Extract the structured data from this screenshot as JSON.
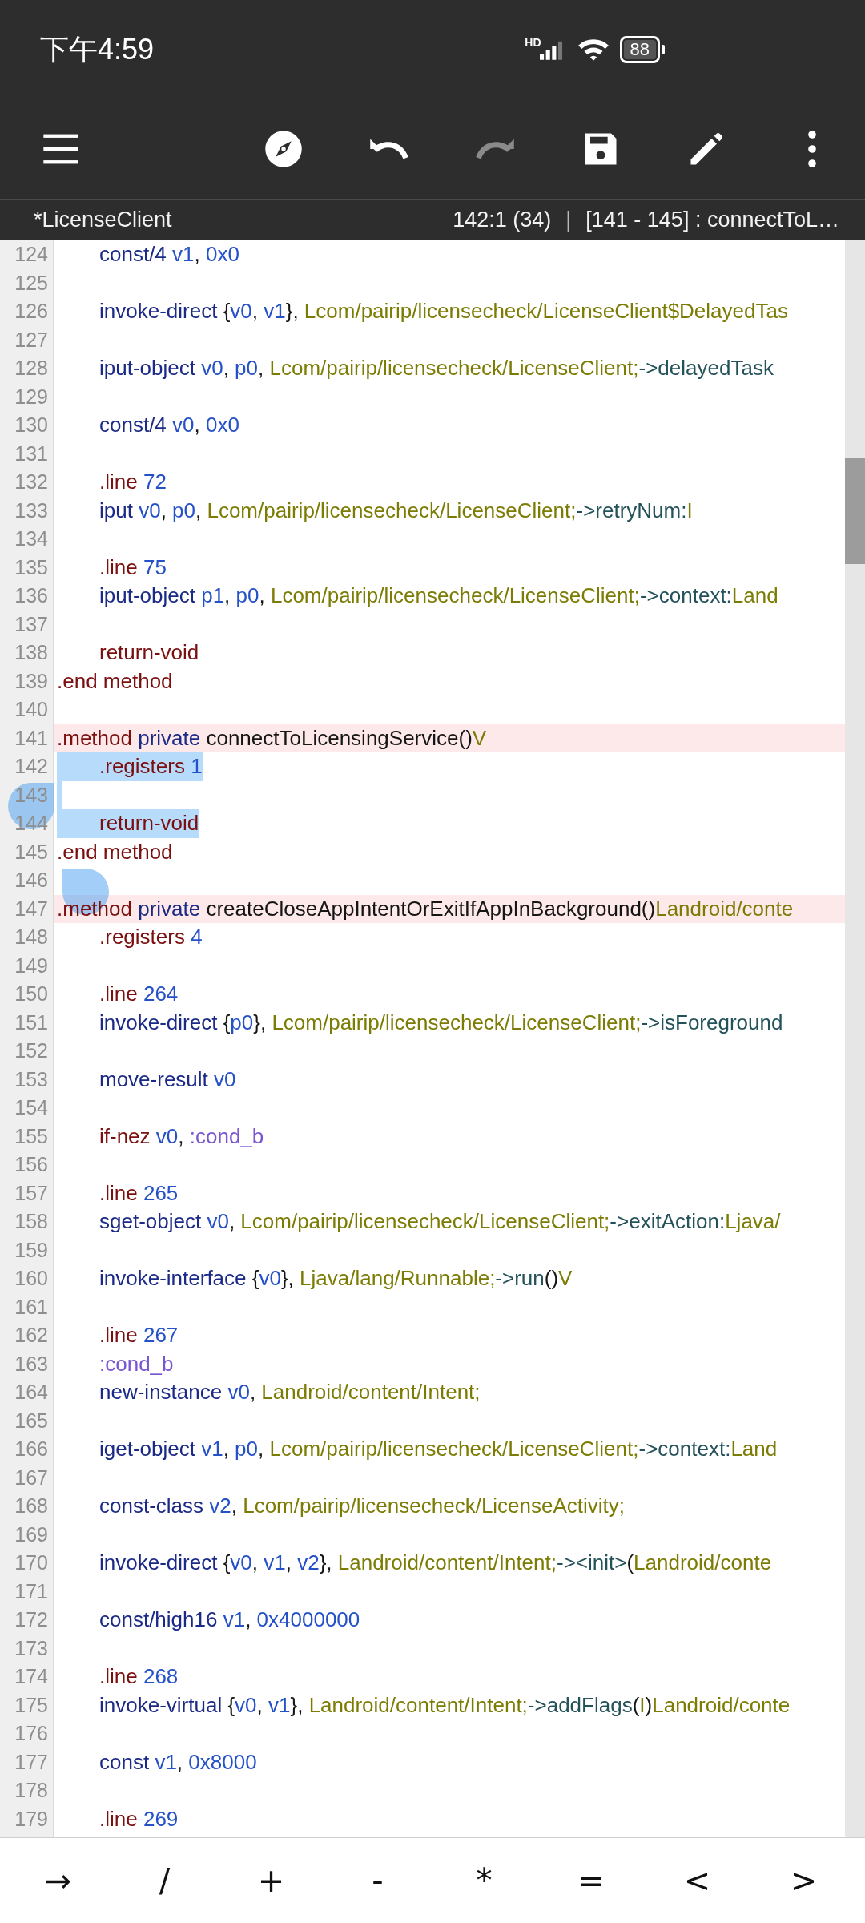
{
  "status_bar": {
    "time": "下午4:59",
    "network": "HD",
    "battery": "88"
  },
  "toolbar": [
    {
      "kind": "menu",
      "disabled": false
    },
    {
      "kind": "compass",
      "disabled": false
    },
    {
      "kind": "undo",
      "disabled": false
    },
    {
      "kind": "redo",
      "disabled": true
    },
    {
      "kind": "save",
      "disabled": false
    },
    {
      "kind": "edit",
      "disabled": false
    },
    {
      "kind": "more",
      "disabled": false
    }
  ],
  "file_bar": {
    "file_name": "*LicenseClient",
    "cursor": "142:1 (34)",
    "separator": "|",
    "scope": "[141 - 145] : connectToL…"
  },
  "editor": {
    "lines": [
      {
        "number": "124",
        "indented": true,
        "highlighted": false,
        "selected": false,
        "tokens": [
          {
            "text": "const/4 ",
            "kind": "op"
          },
          {
            "text": "v1",
            "kind": "reg"
          },
          {
            "text": ", ",
            "kind": "plain"
          },
          {
            "text": "0x0",
            "kind": "reg"
          }
        ]
      },
      {
        "number": "125",
        "highlighted": false,
        "selected": false
      },
      {
        "number": "126",
        "indented": true,
        "highlighted": false,
        "selected": false,
        "tokens": [
          {
            "text": "invoke-direct ",
            "kind": "op"
          },
          {
            "text": "{",
            "kind": "plain"
          },
          {
            "text": "v0",
            "kind": "reg"
          },
          {
            "text": ", ",
            "kind": "plain"
          },
          {
            "text": "v1",
            "kind": "reg"
          },
          {
            "text": "}, ",
            "kind": "plain"
          },
          {
            "text": "Lcom/pairip/licensecheck/LicenseClient$DelayedTas",
            "kind": "type"
          }
        ]
      },
      {
        "number": "127",
        "highlighted": false,
        "selected": false
      },
      {
        "number": "128",
        "indented": true,
        "highlighted": false,
        "selected": false,
        "tokens": [
          {
            "text": "iput-object ",
            "kind": "op"
          },
          {
            "text": "v0",
            "kind": "reg"
          },
          {
            "text": ", ",
            "kind": "plain"
          },
          {
            "text": "p0",
            "kind": "reg"
          },
          {
            "text": ", ",
            "kind": "plain"
          },
          {
            "text": "Lcom/pairip/licensecheck/LicenseClient;",
            "kind": "type"
          },
          {
            "text": "->delayedTask",
            "kind": "member"
          }
        ]
      },
      {
        "number": "129",
        "highlighted": false,
        "selected": false
      },
      {
        "number": "130",
        "indented": true,
        "highlighted": false,
        "selected": false,
        "tokens": [
          {
            "text": "const/4 ",
            "kind": "op"
          },
          {
            "text": "v0",
            "kind": "reg"
          },
          {
            "text": ", ",
            "kind": "plain"
          },
          {
            "text": "0x0",
            "kind": "reg"
          }
        ]
      },
      {
        "number": "131",
        "highlighted": false,
        "selected": false
      },
      {
        "number": "132",
        "indented": true,
        "highlighted": false,
        "selected": false,
        "tokens": [
          {
            "text": ".line ",
            "kind": "dir"
          },
          {
            "text": "72",
            "kind": "reg"
          }
        ]
      },
      {
        "number": "133",
        "indented": true,
        "highlighted": false,
        "selected": false,
        "tokens": [
          {
            "text": "iput ",
            "kind": "op"
          },
          {
            "text": "v0",
            "kind": "reg"
          },
          {
            "text": ", ",
            "kind": "plain"
          },
          {
            "text": "p0",
            "kind": "reg"
          },
          {
            "text": ", ",
            "kind": "plain"
          },
          {
            "text": "Lcom/pairip/licensecheck/LicenseClient;",
            "kind": "type"
          },
          {
            "text": "->retryNum:",
            "kind": "member"
          },
          {
            "text": "I",
            "kind": "type"
          }
        ]
      },
      {
        "number": "134",
        "highlighted": false,
        "selected": false
      },
      {
        "number": "135",
        "indented": true,
        "highlighted": false,
        "selected": false,
        "tokens": [
          {
            "text": ".line ",
            "kind": "dir"
          },
          {
            "text": "75",
            "kind": "reg"
          }
        ]
      },
      {
        "number": "136",
        "indented": true,
        "highlighted": false,
        "selected": false,
        "tokens": [
          {
            "text": "iput-object ",
            "kind": "op"
          },
          {
            "text": "p1",
            "kind": "reg"
          },
          {
            "text": ", ",
            "kind": "plain"
          },
          {
            "text": "p0",
            "kind": "reg"
          },
          {
            "text": ", ",
            "kind": "plain"
          },
          {
            "text": "Lcom/pairip/licensecheck/LicenseClient;",
            "kind": "type"
          },
          {
            "text": "->context:",
            "kind": "member"
          },
          {
            "text": "Land",
            "kind": "type"
          }
        ]
      },
      {
        "number": "137",
        "highlighted": false,
        "selected": false
      },
      {
        "number": "138",
        "indented": true,
        "highlighted": false,
        "selected": false,
        "tokens": [
          {
            "text": "return-void",
            "kind": "dir"
          }
        ]
      },
      {
        "number": "139",
        "indented": false,
        "highlighted": false,
        "selected": false,
        "tokens": [
          {
            "text": ".end method",
            "kind": "dir"
          }
        ]
      },
      {
        "number": "140",
        "highlighted": false,
        "selected": false
      },
      {
        "number": "141",
        "indented": false,
        "highlighted": true,
        "selected": false,
        "tokens": [
          {
            "text": ".method ",
            "kind": "dir"
          },
          {
            "text": "private ",
            "kind": "op"
          },
          {
            "text": "connectToLicensingService()",
            "kind": "plain"
          },
          {
            "text": "V",
            "kind": "type"
          }
        ]
      },
      {
        "number": "142",
        "indented": true,
        "highlighted": false,
        "selected": true,
        "tokens": [
          {
            "text": ".registers ",
            "kind": "dir"
          },
          {
            "text": "1",
            "kind": "reg"
          }
        ]
      },
      {
        "number": "143",
        "highlighted": false,
        "selected": true
      },
      {
        "number": "144",
        "indented": true,
        "highlighted": false,
        "selected": true,
        "tokens": [
          {
            "text": "return-void",
            "kind": "dir"
          }
        ]
      },
      {
        "number": "145",
        "indented": false,
        "highlighted": false,
        "selected": false,
        "tokens": [
          {
            "text": ".end method",
            "kind": "dir"
          }
        ]
      },
      {
        "number": "146",
        "highlighted": false,
        "selected": false
      },
      {
        "number": "147",
        "indented": false,
        "highlighted": true,
        "selected": false,
        "tokens": [
          {
            "text": ".method ",
            "kind": "dir"
          },
          {
            "text": "private ",
            "kind": "op"
          },
          {
            "text": "createCloseAppIntentOrExitIfAppInBackground()",
            "kind": "plain"
          },
          {
            "text": "Landroid/conte",
            "kind": "type"
          }
        ]
      },
      {
        "number": "148",
        "indented": true,
        "highlighted": false,
        "selected": false,
        "tokens": [
          {
            "text": ".registers ",
            "kind": "dir"
          },
          {
            "text": "4",
            "kind": "reg"
          }
        ]
      },
      {
        "number": "149",
        "highlighted": false,
        "selected": false
      },
      {
        "number": "150",
        "indented": true,
        "highlighted": false,
        "selected": false,
        "tokens": [
          {
            "text": ".line ",
            "kind": "dir"
          },
          {
            "text": "264",
            "kind": "reg"
          }
        ]
      },
      {
        "number": "151",
        "indented": true,
        "highlighted": false,
        "selected": false,
        "tokens": [
          {
            "text": "invoke-direct ",
            "kind": "op"
          },
          {
            "text": "{",
            "kind": "plain"
          },
          {
            "text": "p0",
            "kind": "reg"
          },
          {
            "text": "}, ",
            "kind": "plain"
          },
          {
            "text": "Lcom/pairip/licensecheck/LicenseClient;",
            "kind": "type"
          },
          {
            "text": "->isForeground",
            "kind": "member"
          }
        ]
      },
      {
        "number": "152",
        "highlighted": false,
        "selected": false
      },
      {
        "number": "153",
        "indented": true,
        "highlighted": false,
        "selected": false,
        "tokens": [
          {
            "text": "move-result ",
            "kind": "op"
          },
          {
            "text": "v0",
            "kind": "reg"
          }
        ]
      },
      {
        "number": "154",
        "highlighted": false,
        "selected": false
      },
      {
        "number": "155",
        "indented": true,
        "highlighted": false,
        "selected": false,
        "tokens": [
          {
            "text": "if-nez ",
            "kind": "dir"
          },
          {
            "text": "v0",
            "kind": "reg"
          },
          {
            "text": ", ",
            "kind": "plain"
          },
          {
            "text": ":cond_b",
            "kind": "label"
          }
        ]
      },
      {
        "number": "156",
        "highlighted": false,
        "selected": false
      },
      {
        "number": "157",
        "indented": true,
        "highlighted": false,
        "selected": false,
        "tokens": [
          {
            "text": ".line ",
            "kind": "dir"
          },
          {
            "text": "265",
            "kind": "reg"
          }
        ]
      },
      {
        "number": "158",
        "indented": true,
        "highlighted": false,
        "selected": false,
        "tokens": [
          {
            "text": "sget-object ",
            "kind": "op"
          },
          {
            "text": "v0",
            "kind": "reg"
          },
          {
            "text": ", ",
            "kind": "plain"
          },
          {
            "text": "Lcom/pairip/licensecheck/LicenseClient;",
            "kind": "type"
          },
          {
            "text": "->exitAction:",
            "kind": "member"
          },
          {
            "text": "Ljava/",
            "kind": "type"
          }
        ]
      },
      {
        "number": "159",
        "highlighted": false,
        "selected": false
      },
      {
        "number": "160",
        "indented": true,
        "highlighted": false,
        "selected": false,
        "tokens": [
          {
            "text": "invoke-interface ",
            "kind": "op"
          },
          {
            "text": "{",
            "kind": "plain"
          },
          {
            "text": "v0",
            "kind": "reg"
          },
          {
            "text": "}, ",
            "kind": "plain"
          },
          {
            "text": "Ljava/lang/Runnable;",
            "kind": "type"
          },
          {
            "text": "->run",
            "kind": "member"
          },
          {
            "text": "()",
            "kind": "plain"
          },
          {
            "text": "V",
            "kind": "type"
          }
        ]
      },
      {
        "number": "161",
        "highlighted": false,
        "selected": false
      },
      {
        "number": "162",
        "indented": true,
        "highlighted": false,
        "selected": false,
        "tokens": [
          {
            "text": ".line ",
            "kind": "dir"
          },
          {
            "text": "267",
            "kind": "reg"
          }
        ]
      },
      {
        "number": "163",
        "indented": true,
        "highlighted": false,
        "selected": false,
        "tokens": [
          {
            "text": ":cond_b",
            "kind": "label"
          }
        ]
      },
      {
        "number": "164",
        "indented": true,
        "highlighted": false,
        "selected": false,
        "tokens": [
          {
            "text": "new-instance ",
            "kind": "op"
          },
          {
            "text": "v0",
            "kind": "reg"
          },
          {
            "text": ", ",
            "kind": "plain"
          },
          {
            "text": "Landroid/content/Intent;",
            "kind": "type"
          }
        ]
      },
      {
        "number": "165",
        "highlighted": false,
        "selected": false
      },
      {
        "number": "166",
        "indented": true,
        "highlighted": false,
        "selected": false,
        "tokens": [
          {
            "text": "iget-object ",
            "kind": "op"
          },
          {
            "text": "v1",
            "kind": "reg"
          },
          {
            "text": ", ",
            "kind": "plain"
          },
          {
            "text": "p0",
            "kind": "reg"
          },
          {
            "text": ", ",
            "kind": "plain"
          },
          {
            "text": "Lcom/pairip/licensecheck/LicenseClient;",
            "kind": "type"
          },
          {
            "text": "->context:",
            "kind": "member"
          },
          {
            "text": "Land",
            "kind": "type"
          }
        ]
      },
      {
        "number": "167",
        "highlighted": false,
        "selected": false
      },
      {
        "number": "168",
        "indented": true,
        "highlighted": false,
        "selected": false,
        "tokens": [
          {
            "text": "const-class ",
            "kind": "op"
          },
          {
            "text": "v2",
            "kind": "reg"
          },
          {
            "text": ", ",
            "kind": "plain"
          },
          {
            "text": "Lcom/pairip/licensecheck/LicenseActivity;",
            "kind": "type"
          }
        ]
      },
      {
        "number": "169",
        "highlighted": false,
        "selected": false
      },
      {
        "number": "170",
        "indented": true,
        "highlighted": false,
        "selected": false,
        "tokens": [
          {
            "text": "invoke-direct ",
            "kind": "op"
          },
          {
            "text": "{",
            "kind": "plain"
          },
          {
            "text": "v0",
            "kind": "reg"
          },
          {
            "text": ", ",
            "kind": "plain"
          },
          {
            "text": "v1",
            "kind": "reg"
          },
          {
            "text": ", ",
            "kind": "plain"
          },
          {
            "text": "v2",
            "kind": "reg"
          },
          {
            "text": "}, ",
            "kind": "plain"
          },
          {
            "text": "Landroid/content/Intent;",
            "kind": "type"
          },
          {
            "text": "-><init>",
            "kind": "member"
          },
          {
            "text": "(",
            "kind": "plain"
          },
          {
            "text": "Landroid/conte",
            "kind": "type"
          }
        ]
      },
      {
        "number": "171",
        "highlighted": false,
        "selected": false
      },
      {
        "number": "172",
        "indented": true,
        "highlighted": false,
        "selected": false,
        "tokens": [
          {
            "text": "const/high16 ",
            "kind": "op"
          },
          {
            "text": "v1",
            "kind": "reg"
          },
          {
            "text": ", ",
            "kind": "plain"
          },
          {
            "text": "0x4000000",
            "kind": "reg"
          }
        ]
      },
      {
        "number": "173",
        "highlighted": false,
        "selected": false
      },
      {
        "number": "174",
        "indented": true,
        "highlighted": false,
        "selected": false,
        "tokens": [
          {
            "text": ".line ",
            "kind": "dir"
          },
          {
            "text": "268",
            "kind": "reg"
          }
        ]
      },
      {
        "number": "175",
        "indented": true,
        "highlighted": false,
        "selected": false,
        "tokens": [
          {
            "text": "invoke-virtual ",
            "kind": "op"
          },
          {
            "text": "{",
            "kind": "plain"
          },
          {
            "text": "v0",
            "kind": "reg"
          },
          {
            "text": ", ",
            "kind": "plain"
          },
          {
            "text": "v1",
            "kind": "reg"
          },
          {
            "text": "}, ",
            "kind": "plain"
          },
          {
            "text": "Landroid/content/Intent;",
            "kind": "type"
          },
          {
            "text": "->addFlags",
            "kind": "member"
          },
          {
            "text": "(",
            "kind": "plain"
          },
          {
            "text": "I",
            "kind": "type"
          },
          {
            "text": ")",
            "kind": "plain"
          },
          {
            "text": "Landroid/conte",
            "kind": "type"
          }
        ]
      },
      {
        "number": "176",
        "highlighted": false,
        "selected": false
      },
      {
        "number": "177",
        "indented": true,
        "highlighted": false,
        "selected": false,
        "tokens": [
          {
            "text": "const ",
            "kind": "op"
          },
          {
            "text": "v1",
            "kind": "reg"
          },
          {
            "text": ", ",
            "kind": "plain"
          },
          {
            "text": "0x8000",
            "kind": "reg"
          }
        ]
      },
      {
        "number": "178",
        "highlighted": false,
        "selected": false
      },
      {
        "number": "179",
        "indented": true,
        "highlighted": false,
        "selected": false,
        "tokens": [
          {
            "text": ".line ",
            "kind": "dir"
          },
          {
            "text": "269",
            "kind": "reg"
          }
        ]
      }
    ]
  },
  "symbol_keys": [
    "→",
    "/",
    "+",
    "-",
    "*",
    "=",
    "<",
    ">"
  ]
}
